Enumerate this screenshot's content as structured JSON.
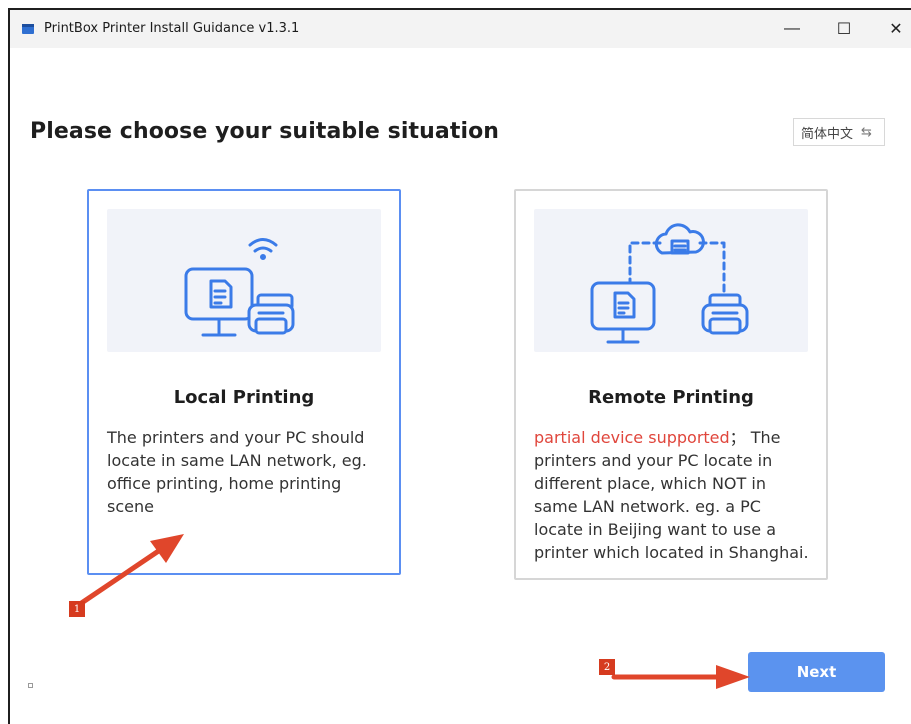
{
  "window": {
    "title": "PrintBox Printer Install Guidance v1.3.1",
    "controls": {
      "minimize": "—",
      "maximize": "☐",
      "close": "✕"
    }
  },
  "heading": "Please choose your suitable situation",
  "language": {
    "label": "简体中文",
    "icon": "swap-arrows-icon",
    "swap_glyph": "⇆"
  },
  "options": [
    {
      "title": "Local Printing",
      "description": "The printers and your PC should locate in same LAN network, eg. office printing, home printing scene",
      "selected": true
    },
    {
      "title": "Remote Printing",
      "warning": "partial device supported",
      "description": "；  The printers and your PC locate in different place, which NOT in same LAN network. eg. a PC locate in Beijing want to use a printer which located in Shanghai.",
      "selected": false
    }
  ],
  "next_button": "Next",
  "annotations": {
    "badge_1": "1",
    "badge_2": "2"
  },
  "colors": {
    "accent": "#5b93ef",
    "selected_border": "#5b8ff2",
    "warning_text": "#e0463c",
    "annotation_red": "#d63b1f",
    "illustration_blue": "#3b7be8"
  }
}
